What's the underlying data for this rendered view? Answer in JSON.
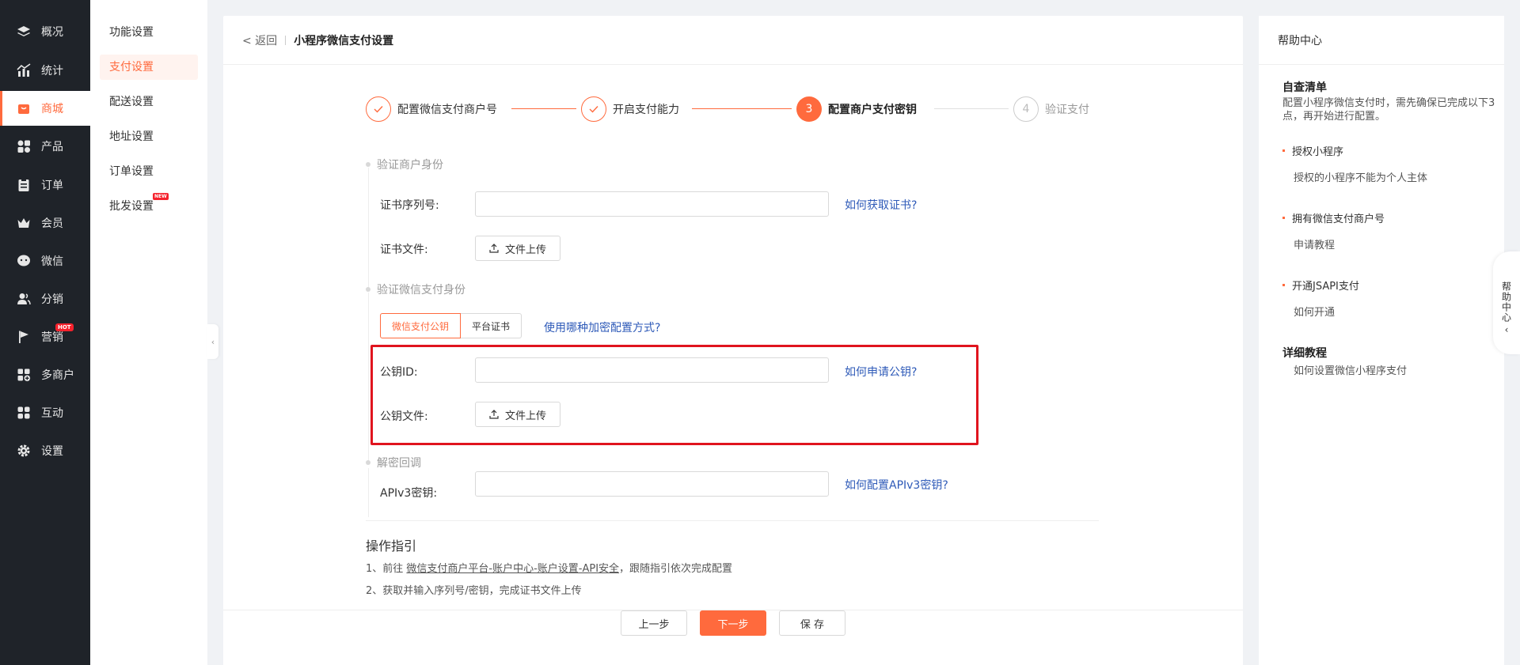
{
  "nav": {
    "items": [
      {
        "label": "概况",
        "icon": "layers-icon"
      },
      {
        "label": "统计",
        "icon": "chart-icon"
      },
      {
        "label": "商城",
        "icon": "shop-icon",
        "active": true
      },
      {
        "label": "产品",
        "icon": "grid-icon"
      },
      {
        "label": "订单",
        "icon": "clipboard-icon"
      },
      {
        "label": "会员",
        "icon": "crown-icon"
      },
      {
        "label": "微信",
        "icon": "wechat-icon"
      },
      {
        "label": "分销",
        "icon": "users-icon"
      },
      {
        "label": "营销",
        "icon": "flag-icon",
        "badge": "HOT"
      },
      {
        "label": "多商户",
        "icon": "store-add-icon"
      },
      {
        "label": "互动",
        "icon": "apps-icon"
      },
      {
        "label": "设置",
        "icon": "gear-icon"
      }
    ]
  },
  "submenu": {
    "items": [
      {
        "label": "功能设置"
      },
      {
        "label": "支付设置",
        "active": true
      },
      {
        "label": "配送设置"
      },
      {
        "label": "地址设置"
      },
      {
        "label": "订单设置"
      },
      {
        "label": "批发设置",
        "badge": "NEW"
      }
    ]
  },
  "header": {
    "back": "< 返回",
    "title": "小程序微信支付设置"
  },
  "steps": [
    {
      "label": "配置微信支付商户号",
      "state": "done"
    },
    {
      "label": "开启支付能力",
      "state": "done"
    },
    {
      "num": "3",
      "label": "配置商户支付密钥",
      "state": "current"
    },
    {
      "num": "4",
      "label": "验证支付",
      "state": "wait"
    }
  ],
  "form": {
    "sec1": "验证商户身份",
    "cert_serial_label": "证书序列号:",
    "cert_serial_value": "",
    "cert_link": "如何获取证书?",
    "cert_file_label": "证书文件:",
    "upload_label": "文件上传",
    "sec2": "验证微信支付身份",
    "tab_public_key": "微信支付公钥",
    "tab_platform_cert": "平台证书",
    "encrypt_link": "使用哪种加密配置方式?",
    "pubkey_id_label": "公钥ID:",
    "pubkey_id_value": "",
    "pubkey_link": "如何申请公钥?",
    "pubkey_file_label": "公钥文件:",
    "sec3": "解密回调",
    "apiv3_label": "APIv3密钥:",
    "apiv3_value": "",
    "apiv3_link": "如何配置APIv3密钥?"
  },
  "guide": {
    "title": "操作指引",
    "step1_prefix": "1、前往 ",
    "step1_link": "微信支付商户平台-账户中心-账户设置-API安全",
    "step1_suffix": "，跟随指引依次完成配置",
    "step2": "2、获取并输入序列号/密钥，完成证书文件上传"
  },
  "footer": {
    "prev": "上一步",
    "next": "下一步",
    "save": "保 存"
  },
  "help": {
    "title": "帮助中心",
    "checklist_title": "自查清单",
    "checklist_desc": "配置小程序微信支付时，需先确保已完成以下3点，再开始进行配置。",
    "item1": "授权小程序",
    "item1_sub": "授权的小程序不能为个人主体",
    "item2": "拥有微信支付商户号",
    "item2_sub": "申请教程",
    "item3": "开通JSAPI支付",
    "item3_sub": "如何开通",
    "tutorial_title": "详细教程",
    "tutorial_sub": "如何设置微信小程序支付",
    "side_tab": "帮助中心"
  },
  "colors": {
    "accent": "#ff6a3d",
    "link": "#2e5ab8",
    "highlight_box": "#e0141e",
    "sidebar_bg": "#1f2329"
  }
}
